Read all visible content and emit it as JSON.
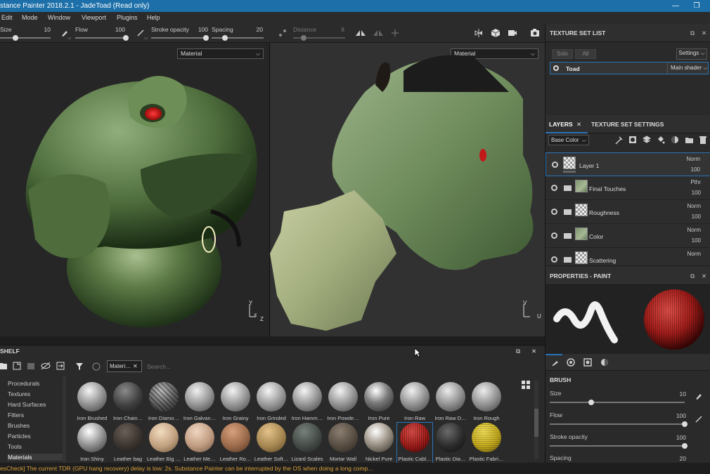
{
  "window": {
    "title": "stance Painter 2018.2.1 - JadeToad (Read only)",
    "minimize_glyph": "—",
    "restore_glyph": "❐"
  },
  "menu": [
    "Edit",
    "Mode",
    "Window",
    "Viewport",
    "Plugins",
    "Help"
  ],
  "toolbar": {
    "size_label": "Size",
    "size_value": "10",
    "flow_label": "Flow",
    "flow_value": "100",
    "stroke_label": "Stroke opacity",
    "stroke_value": "100",
    "spacing_label": "Spacing",
    "spacing_value": "20",
    "distance_label": "Distance",
    "distance_value": "8"
  },
  "viewport3d": {
    "material_select": "Material",
    "axis_y": "Y",
    "axis_x": "X",
    "axis_z": "Z"
  },
  "viewportuv": {
    "material_select": "Material",
    "axis_v": "V",
    "axis_u": "U"
  },
  "texture_set_list": {
    "title": "TEXTURE SET LIST",
    "solo": "Solo",
    "all": "All",
    "settings": "Settings",
    "set_name": "Toad",
    "shader": "Main shader"
  },
  "layers_panel": {
    "tab_layers": "LAYERS",
    "tab_tss": "TEXTURE SET SETTINGS",
    "channel": "Base Color",
    "layers": [
      {
        "name": "Layer 1",
        "blend": "Norm",
        "opacity": "100"
      },
      {
        "name": "Final Touches",
        "blend": "Pthr",
        "opacity": "100"
      },
      {
        "name": "Roughness",
        "blend": "Norm",
        "opacity": "100"
      },
      {
        "name": "Color",
        "blend": "Norm",
        "opacity": "100"
      },
      {
        "name": "Scattering",
        "blend": "Norm",
        "opacity": ""
      }
    ]
  },
  "properties": {
    "title": "PROPERTIES - PAINT",
    "brush_header": "BRUSH",
    "size_label": "Size",
    "size_value": "10",
    "flow_label": "Flow",
    "flow_value": "100",
    "stroke_label": "Stroke opacity",
    "stroke_value": "100",
    "spacing_label": "Spacing",
    "spacing_value": "20"
  },
  "shelf": {
    "title": "SHELF",
    "filter_tag": "Materi…",
    "search_placeholder": "Search...",
    "categories": [
      "Procedurals",
      "Textures",
      "Hard Surfaces",
      "Filters",
      "Brushes",
      "Particles",
      "Tools",
      "Materials"
    ],
    "materials_row1": [
      "Iron Brushed",
      "Iron Chain…",
      "Iron Diamo…",
      "Iron Galvan…",
      "Iron Grainy",
      "Iron Grinded",
      "Iron Hamm…",
      "Iron Powde…",
      "Iron Pure",
      "Iron Raw",
      "Iron Raw D…",
      "Iron Rough"
    ],
    "materials_row2": [
      "Iron Shiny",
      "Leather bag",
      "Leather Big …",
      "Leather Me…",
      "Leather Ro…",
      "Leather Soft…",
      "Lizard Scales",
      "Mortar Wall",
      "Nickel Pure",
      "Plastic Cabl…",
      "Plastic Dia…",
      "Plastic Fabri…"
    ]
  },
  "status": "esCheck] The current TDR (GPU hang recovery) delay is low: 2s. Substance Painter can be interrupted by the OS when doing a long comp…"
}
